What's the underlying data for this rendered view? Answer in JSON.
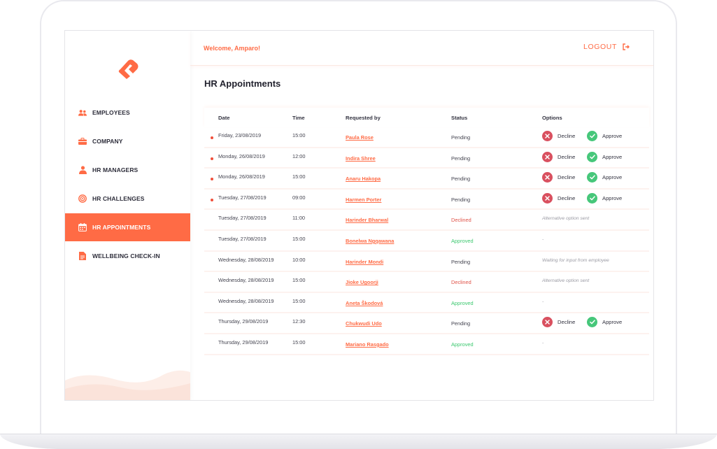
{
  "welcome": "Welcome, Amparo!",
  "logout_label": "LOGOUT",
  "page_title": "HR Appointments",
  "nav": [
    {
      "label": "EMPLOYEES",
      "icon": "users-icon"
    },
    {
      "label": "COMPANY",
      "icon": "briefcase-icon"
    },
    {
      "label": "HR MANAGERS",
      "icon": "user-icon"
    },
    {
      "label": "HR CHALLENGES",
      "icon": "target-icon"
    },
    {
      "label": "HR APPOINTMENTS",
      "icon": "calendar-icon",
      "active": true
    },
    {
      "label": "WELLBEING CHECK-IN",
      "icon": "document-icon"
    }
  ],
  "columns": {
    "date": "Date",
    "time": "Time",
    "requested_by": "Requested by",
    "status": "Status",
    "options": "Options"
  },
  "actions": {
    "decline": "Decline",
    "approve": "Approve"
  },
  "rows": [
    {
      "date": "Friday, 23/08/2019",
      "time": "15:00",
      "requested_by": "Paula Rose",
      "status": "Pending",
      "unread": true,
      "options": "actions",
      "note": ""
    },
    {
      "date": "Monday, 26/08/2019",
      "time": "12:00",
      "requested_by": "Indira Shree",
      "status": "Pending",
      "unread": true,
      "options": "actions",
      "note": ""
    },
    {
      "date": "Monday, 26/08/2019",
      "time": "15:00",
      "requested_by": "Anaru Hakopa",
      "status": "Pending",
      "unread": true,
      "options": "actions",
      "note": ""
    },
    {
      "date": "Tuesday, 27/08/2019",
      "time": "09:00",
      "requested_by": "Harmen Porter",
      "status": "Pending",
      "unread": true,
      "options": "actions",
      "note": ""
    },
    {
      "date": "Tuesday, 27/08/2019",
      "time": "11:00",
      "requested_by": "Harinder Bharwal",
      "status": "Declined",
      "unread": false,
      "options": "note",
      "note": "Alternative option sent"
    },
    {
      "date": "Tuesday, 27/08/2019",
      "time": "15:00",
      "requested_by": "Bonelwa Ngqawana",
      "status": "Approved",
      "unread": false,
      "options": "note",
      "note": "-"
    },
    {
      "date": "Wednesday, 28/08/2019",
      "time": "10:00",
      "requested_by": "Harinder Mondi",
      "status": "Pending",
      "unread": false,
      "options": "note",
      "note": "Waiting for input from employee"
    },
    {
      "date": "Wednesday, 28/08/2019",
      "time": "15:00",
      "requested_by": "Jioke Ugoorji",
      "status": "Declined",
      "unread": false,
      "options": "note",
      "note": "Alternative option sent"
    },
    {
      "date": "Wednesday, 28/08/2019",
      "time": "15:00",
      "requested_by": "Aneta Škodová",
      "status": "Approved",
      "unread": false,
      "options": "note",
      "note": "-"
    },
    {
      "date": "Thursday, 29/08/2019",
      "time": "12:30",
      "requested_by": "Chukwudi Udo",
      "status": "Pending",
      "unread": false,
      "options": "actions",
      "note": ""
    },
    {
      "date": "Thursday, 29/08/2019",
      "time": "15:00",
      "requested_by": "Mariano Rasgado",
      "status": "Approved",
      "unread": false,
      "options": "note",
      "note": "-"
    }
  ],
  "colors": {
    "accent": "#ff6b45",
    "decline": "#d9505f",
    "approve": "#46c77a",
    "declined_text": "#e0544a",
    "approved_text": "#3cc86f"
  }
}
